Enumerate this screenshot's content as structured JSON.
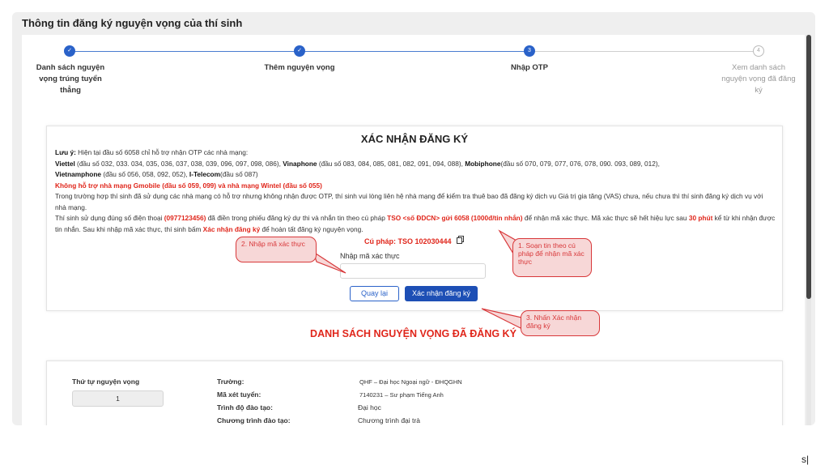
{
  "page_title": "Thông tin đăng ký nguyện vọng của thí sinh",
  "stepper": {
    "steps": [
      {
        "label": "Danh sách nguyện vọng trúng tuyển thẳng",
        "marker": "✓",
        "state": "done"
      },
      {
        "label": "Thêm nguyện vọng",
        "marker": "✓",
        "state": "done"
      },
      {
        "label": "Nhập OTP",
        "marker": "3",
        "state": "active"
      },
      {
        "label": "Xem danh sách nguyện vọng đã đăng ký",
        "marker": "4",
        "state": "todo"
      }
    ]
  },
  "confirm": {
    "heading": "XÁC NHẬN ĐĂNG KÝ",
    "note_label": "Lưu ý:",
    "note_text": " Hiện tại đầu số 6058 chỉ hỗ trợ nhận OTP các nhà mạng:",
    "viettel": "Viettel",
    "viettel_prefixes": " (đầu số 032, 033. 034, 035, 036, 037, 038, 039, 096, 097, 098, 086), ",
    "vinaphone": "Vinaphone",
    "vinaphone_prefixes": " (đầu số 083, 084, 085, 081, 082, 091, 094, 088), ",
    "mobiphone": "Mobiphone",
    "mobiphone_prefixes": "(đầu số 070, 079, 077, 076, 078, 090. 093, 089, 012),",
    "vietnamphone": "Vietnamphone",
    "vietnamphone_prefixes": " (đầu số 056, 058, 092, 052), ",
    "itelecom": "I-Telecom",
    "itelecom_prefixes": "(đầu số 087)",
    "unsupported": "Không hỗ trợ nhà mạng Gmobile (đầu số 059, 099) và nhà mạng Wintel (đầu số 055)",
    "vas_note": "Trong trường hợp thí sinh đã sử dụng các nhà mạng có hỗ trợ nhưng không nhận được OTP, thí sinh vui lòng liên hệ nhà mạng để kiểm tra thuê bao đã đăng ký dịch vụ Giá trị gia tăng (VAS) chưa, nếu chưa thì thí sinh đăng ký dịch vụ với nhà mạng.",
    "instr_1": "Thí sinh sử dụng đúng số điện thoại ",
    "phone": "(0977123456)",
    "instr_2": " đã điền trong phiếu đăng ký dự thi và nhắn tin theo cú pháp ",
    "sms_syntax": "TSO <số ĐDCN> gửi 6058 (1000đ/tin nhắn)",
    "instr_3": " để nhận mã xác thực. Mã xác thực sẽ hết hiệu lực sau ",
    "validity": "30 phút",
    "instr_4": " kể từ khi nhận được tin nhắn. Sau khi nhập mã xác thực, thí sinh bấm ",
    "confirm_word": "Xác nhận đăng ký",
    "instr_5": " để hoàn tất đăng ký nguyện vọng.",
    "syntax_line": "Cú pháp: TSO 102030444",
    "otp_label": "Nhập mã xác thực",
    "otp_value": "",
    "otp_placeholder": "",
    "back_label": "Quay lại",
    "confirm_label": "Xác nhận đăng ký"
  },
  "callouts": {
    "c1": "1. Soạn tin theo cú pháp để nhận mã xác thực",
    "c2": "2. Nhập mã xác thực",
    "c3": "3. Nhấn Xác nhận đăng ký"
  },
  "registered": {
    "title": "DANH SÁCH NGUYỆN VỌNG ĐÃ ĐĂNG KÝ",
    "order_label": "Thứ tự nguyện vọng",
    "order_value": "1",
    "school_label": "Trường:",
    "school_value": "QHF – Đại học Ngoại ngữ - ĐHQGHN",
    "code_label": "Mã xét tuyển:",
    "code_value": "7140231 – Sư phạm Tiếng Anh",
    "level_label": "Trình độ đào tạo:",
    "level_value": "Đại học",
    "program_label": "Chương trình đào tạo:",
    "program_value": "Chương trình đại trà"
  },
  "stray_char": "s|",
  "colors": {
    "primary": "#1d4fb5",
    "accent_red": "#e0261b",
    "callout_border": "#d8383a",
    "callout_fill": "#f7d7d7"
  }
}
